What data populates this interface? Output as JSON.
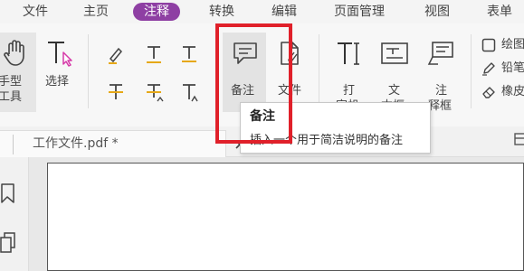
{
  "menu": {
    "items": [
      {
        "label": "文件",
        "active": false
      },
      {
        "label": "主页",
        "active": false
      },
      {
        "label": "注释",
        "active": true
      },
      {
        "label": "转换",
        "active": false
      },
      {
        "label": "编辑",
        "active": false
      },
      {
        "label": "页面管理",
        "active": false
      },
      {
        "label": "视图",
        "active": false
      },
      {
        "label": "表单",
        "active": false
      }
    ]
  },
  "ribbon": {
    "hand_tool": {
      "line1": "手型",
      "line2": "工具"
    },
    "select": {
      "label": "选择"
    },
    "note": {
      "label": "备注"
    },
    "file": {
      "label": "文件"
    },
    "typewriter": {
      "line1": "打",
      "line2": "字机"
    },
    "textbox": {
      "line1": "文",
      "line2": "本框"
    },
    "callout": {
      "line1": "注",
      "line2": "释框"
    },
    "draw": {
      "label": "绘图"
    },
    "pencil": {
      "label": "铅笔"
    },
    "eraser": {
      "label": "橡皮"
    }
  },
  "tooltip": {
    "title": "备注",
    "description": "插入一个用于简洁说明的备注"
  },
  "document": {
    "tab_title": "工作文件.pdf *"
  },
  "colors": {
    "accent": "#8e3fa3",
    "highlight": "#e0202a",
    "text_tool_yellow": "#e6a817",
    "select_cursor": "#d63aa8"
  }
}
